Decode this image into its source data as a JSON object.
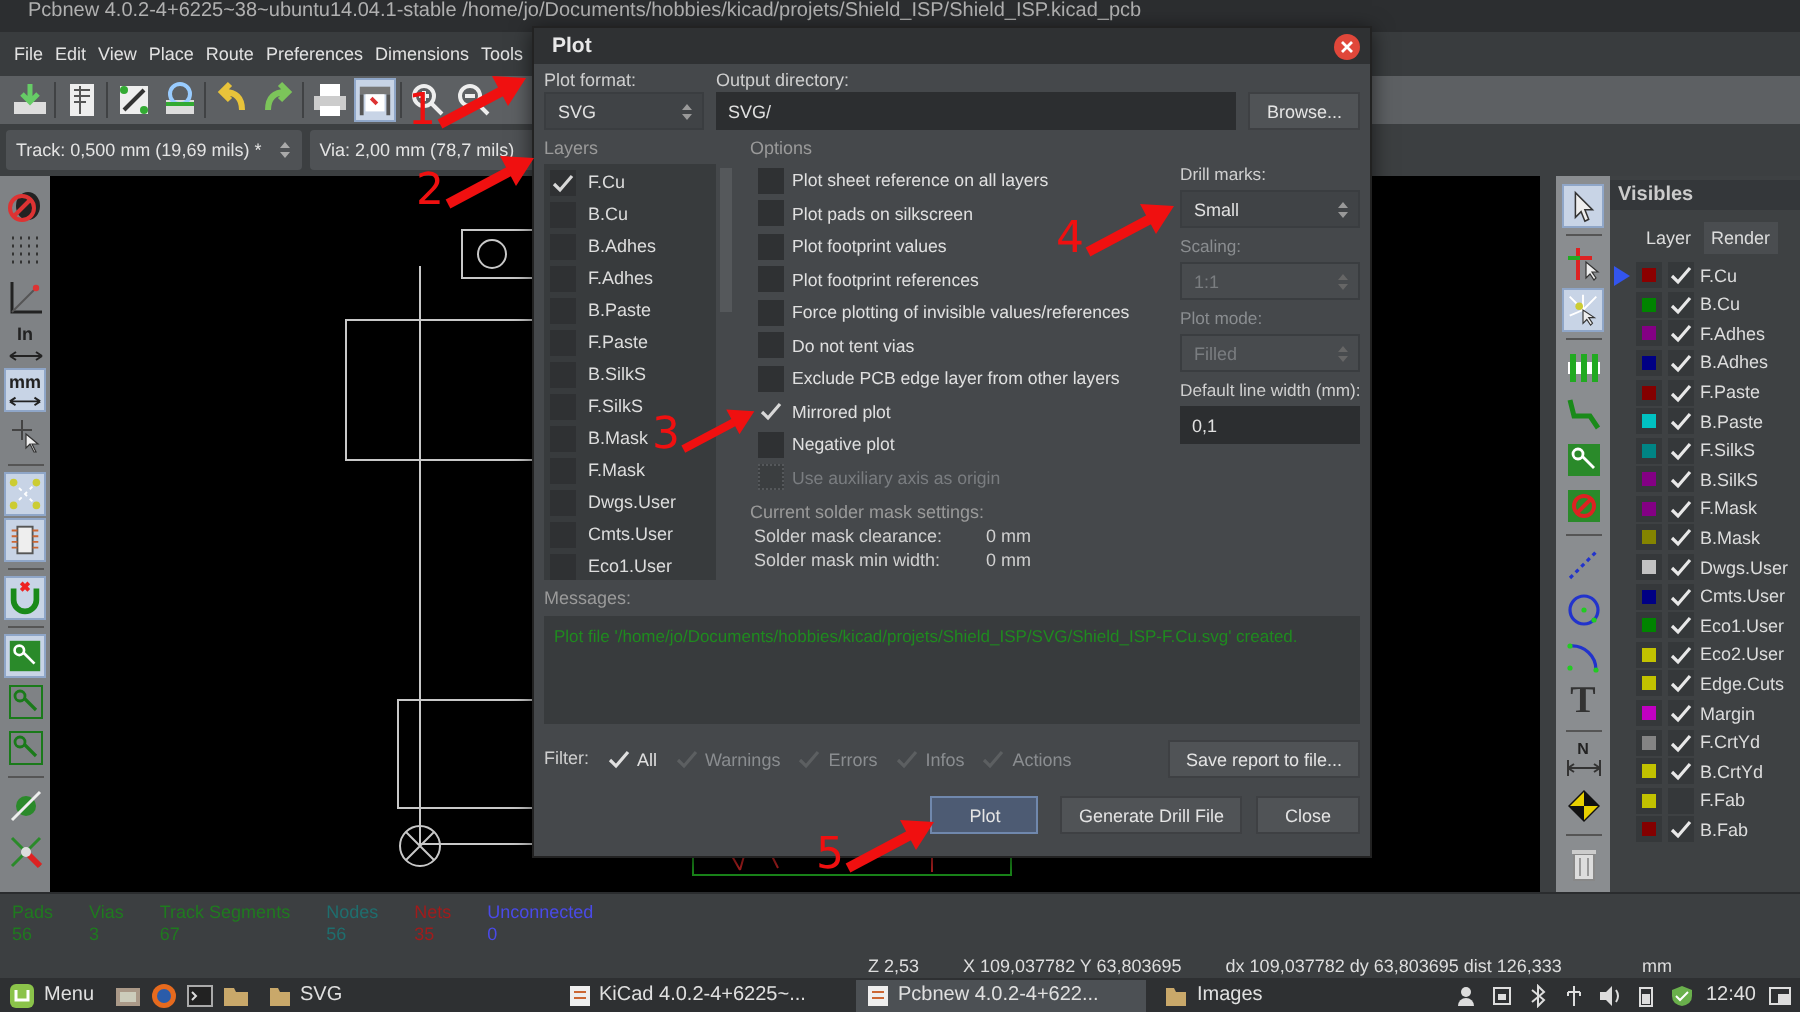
{
  "window": {
    "title": "Pcbnew 4.0.2-4+6225~38~ubuntu14.04.1-stable /home/jo/Documents/hobbies/kicad/projets/Shield_ISP/Shield_ISP.kicad_pcb"
  },
  "menu": [
    "File",
    "Edit",
    "View",
    "Place",
    "Route",
    "Preferences",
    "Dimensions",
    "Tools"
  ],
  "toolbar": [
    {
      "kind": "load",
      "selected": false
    },
    {
      "kind": "sep"
    },
    {
      "kind": "page",
      "selected": false
    },
    {
      "kind": "sep"
    },
    {
      "kind": "netlist",
      "selected": false
    },
    {
      "kind": "inspect",
      "selected": false
    },
    {
      "kind": "sep"
    },
    {
      "kind": "undo",
      "selected": false
    },
    {
      "kind": "redo",
      "selected": false
    },
    {
      "kind": "sep"
    },
    {
      "kind": "print",
      "selected": false
    },
    {
      "kind": "plot",
      "selected": true
    },
    {
      "kind": "sep"
    },
    {
      "kind": "zoom-in",
      "selected": false
    },
    {
      "kind": "zoom-out",
      "selected": false
    }
  ],
  "track_select": "Track: 0,500 mm (19,69 mils) *",
  "via_select": "Via: 2,00 mm (78,7 mils)",
  "left_toolbar": [
    {
      "kind": "drc-off",
      "selected": false
    },
    {
      "kind": "grid",
      "selected": false
    },
    {
      "kind": "polar",
      "selected": false
    },
    {
      "kind": "units",
      "label": "In",
      "selected": false
    },
    {
      "kind": "units",
      "label": "mm",
      "selected": true
    },
    {
      "kind": "cursor",
      "selected": false
    },
    {
      "kind": "sep"
    },
    {
      "kind": "ratsnest",
      "selected": true
    },
    {
      "kind": "chip",
      "selected": true
    },
    {
      "kind": "sep"
    },
    {
      "kind": "magnet",
      "selected": true
    },
    {
      "kind": "sep"
    },
    {
      "kind": "zone",
      "selected": true
    },
    {
      "kind": "zone-outline",
      "selected": false
    },
    {
      "kind": "zone-outline",
      "selected": false
    },
    {
      "kind": "sep"
    },
    {
      "kind": "pad",
      "selected": false
    },
    {
      "kind": "via",
      "selected": false
    }
  ],
  "right_toolbar": [
    {
      "kind": "select",
      "selected": true
    },
    {
      "kind": "sep"
    },
    {
      "kind": "highlight",
      "selected": false
    },
    {
      "kind": "local",
      "selected": true
    },
    {
      "kind": "sep"
    },
    {
      "kind": "module",
      "selected": false
    },
    {
      "kind": "track",
      "selected": false
    },
    {
      "kind": "zone",
      "selected": false
    },
    {
      "kind": "keepout",
      "selected": false
    },
    {
      "kind": "sep"
    },
    {
      "kind": "line",
      "selected": false
    },
    {
      "kind": "circle",
      "selected": false
    },
    {
      "kind": "arc",
      "selected": false
    },
    {
      "kind": "text",
      "label": "T",
      "selected": false
    },
    {
      "kind": "sep"
    },
    {
      "kind": "dimension",
      "label": "N",
      "selected": false
    },
    {
      "kind": "target",
      "selected": false
    },
    {
      "kind": "sep"
    },
    {
      "kind": "delete",
      "selected": false
    }
  ],
  "visibles": {
    "title": "Visibles",
    "tabs": [
      {
        "label": "Layer",
        "selected": true
      },
      {
        "label": "Render",
        "selected": false
      }
    ],
    "layers": [
      {
        "name": "F.Cu",
        "color": "#8b0000",
        "visible": true,
        "selected": true
      },
      {
        "name": "B.Cu",
        "color": "#008400",
        "visible": true,
        "selected": false
      },
      {
        "name": "F.Adhes",
        "color": "#840084",
        "visible": true,
        "selected": false
      },
      {
        "name": "B.Adhes",
        "color": "#000084",
        "visible": true,
        "selected": false
      },
      {
        "name": "F.Paste",
        "color": "#840000",
        "visible": true,
        "selected": false
      },
      {
        "name": "B.Paste",
        "color": "#00c2c2",
        "visible": true,
        "selected": false
      },
      {
        "name": "F.SilkS",
        "color": "#008484",
        "visible": true,
        "selected": false
      },
      {
        "name": "B.SilkS",
        "color": "#840084",
        "visible": true,
        "selected": false
      },
      {
        "name": "F.Mask",
        "color": "#840084",
        "visible": true,
        "selected": false
      },
      {
        "name": "B.Mask",
        "color": "#848400",
        "visible": true,
        "selected": false
      },
      {
        "name": "Dwgs.User",
        "color": "#c2c2c2",
        "visible": true,
        "selected": false
      },
      {
        "name": "Cmts.User",
        "color": "#000084",
        "visible": true,
        "selected": false
      },
      {
        "name": "Eco1.User",
        "color": "#008400",
        "visible": true,
        "selected": false
      },
      {
        "name": "Eco2.User",
        "color": "#c2c200",
        "visible": true,
        "selected": false
      },
      {
        "name": "Edge.Cuts",
        "color": "#c2c200",
        "visible": true,
        "selected": false
      },
      {
        "name": "Margin",
        "color": "#c200c2",
        "visible": true,
        "selected": false
      },
      {
        "name": "F.CrtYd",
        "color": "#848484",
        "visible": true,
        "selected": false
      },
      {
        "name": "B.CrtYd",
        "color": "#c2c200",
        "visible": true,
        "selected": false
      },
      {
        "name": "F.Fab",
        "color": "#c2c200",
        "visible": false,
        "selected": false
      },
      {
        "name": "B.Fab",
        "color": "#840000",
        "visible": true,
        "selected": false
      }
    ]
  },
  "status": [
    {
      "label": "Pads",
      "value": "56",
      "color": "#1f7a1f"
    },
    {
      "label": "Vias",
      "value": "3",
      "color": "#1f7a1f"
    },
    {
      "label": "Track Segments",
      "value": "67",
      "color": "#1f7a1f"
    },
    {
      "label": "Nodes",
      "value": "56",
      "color": "#1f6e6e"
    },
    {
      "label": "Nets",
      "value": "35",
      "color": "#a01c1c"
    },
    {
      "label": "Unconnected",
      "value": "0",
      "color": "#4a4ae8"
    }
  ],
  "coords": [
    "Z 2,53",
    "X 109,037782  Y 63,803695",
    "dx 109,037782  dy 63,803695  dist 126,333",
    "mm"
  ],
  "taskbar": {
    "menu": "Menu",
    "apps": [
      {
        "label": "SVG",
        "selected": false
      },
      {
        "label": "KiCad 4.0.2-4+6225~...",
        "selected": false
      },
      {
        "label": "Pcbnew 4.0.2-4+622...",
        "selected": true
      },
      {
        "label": "Images",
        "selected": false
      }
    ],
    "clock": "12:40"
  },
  "dialog": {
    "title": "Plot",
    "plot_format": {
      "label": "Plot format:",
      "value": "SVG"
    },
    "output_dir": {
      "label": "Output directory:",
      "value": "SVG/"
    },
    "browse": "Browse...",
    "layers_label": "Layers",
    "layers": [
      {
        "name": "F.Cu",
        "checked": true
      },
      {
        "name": "B.Cu",
        "checked": false
      },
      {
        "name": "B.Adhes",
        "checked": false
      },
      {
        "name": "F.Adhes",
        "checked": false
      },
      {
        "name": "B.Paste",
        "checked": false
      },
      {
        "name": "F.Paste",
        "checked": false
      },
      {
        "name": "B.SilkS",
        "checked": false
      },
      {
        "name": "F.SilkS",
        "checked": false
      },
      {
        "name": "B.Mask",
        "checked": false
      },
      {
        "name": "F.Mask",
        "checked": false
      },
      {
        "name": "Dwgs.User",
        "checked": false
      },
      {
        "name": "Cmts.User",
        "checked": false
      },
      {
        "name": "Eco1.User",
        "checked": false
      }
    ],
    "options_label": "Options",
    "options": [
      {
        "label": "Plot sheet reference on all layers",
        "checked": false,
        "disabled": false
      },
      {
        "label": "Plot pads on silkscreen",
        "checked": false,
        "disabled": false
      },
      {
        "label": "Plot footprint values",
        "checked": false,
        "disabled": false
      },
      {
        "label": "Plot footprint references",
        "checked": false,
        "disabled": false
      },
      {
        "label": "Force plotting of invisible values/references",
        "checked": false,
        "disabled": false
      },
      {
        "label": "Do not tent vias",
        "checked": false,
        "disabled": false
      },
      {
        "label": "Exclude PCB edge layer from other layers",
        "checked": false,
        "disabled": false
      },
      {
        "label": "Mirrored plot",
        "checked": true,
        "disabled": false
      },
      {
        "label": "Negative plot",
        "checked": false,
        "disabled": false
      },
      {
        "label": "Use auxiliary axis as origin",
        "checked": false,
        "disabled": true
      }
    ],
    "settings": [
      {
        "kind": "select",
        "label": "Drill marks:",
        "value": "Small",
        "disabled": false
      },
      {
        "kind": "select",
        "label": "Scaling:",
        "value": "1:1",
        "disabled": true
      },
      {
        "kind": "select",
        "label": "Plot mode:",
        "value": "Filled",
        "disabled": true
      },
      {
        "kind": "input",
        "label": "Default line width (mm):",
        "value": "0,1",
        "disabled": false
      }
    ],
    "solder_mask": {
      "title": "Current solder mask settings:",
      "rows": [
        {
          "label": "Solder mask clearance:",
          "value": "0 mm"
        },
        {
          "label": "Solder mask min width:",
          "value": "0 mm"
        }
      ]
    },
    "messages_label": "Messages:",
    "messages": [
      "Plot file '/home/jo/Documents/hobbies/kicad/projets/Shield_ISP/SVG/Shield_ISP-F.Cu.svg' created."
    ],
    "filter_label": "Filter:",
    "filters": [
      {
        "label": "All",
        "checked": true,
        "disabled": false
      },
      {
        "label": "Warnings",
        "checked": true,
        "disabled": true
      },
      {
        "label": "Errors",
        "checked": true,
        "disabled": true
      },
      {
        "label": "Infos",
        "checked": true,
        "disabled": true
      },
      {
        "label": "Actions",
        "checked": true,
        "disabled": true
      }
    ],
    "save_report": "Save report to file...",
    "buttons": [
      {
        "label": "Plot",
        "selected": true
      },
      {
        "label": "Generate Drill File",
        "selected": false
      },
      {
        "label": "Close",
        "selected": false
      }
    ]
  },
  "annotations": [
    {
      "number": "1"
    },
    {
      "number": "2"
    },
    {
      "number": "3"
    },
    {
      "number": "4"
    },
    {
      "number": "5"
    }
  ]
}
